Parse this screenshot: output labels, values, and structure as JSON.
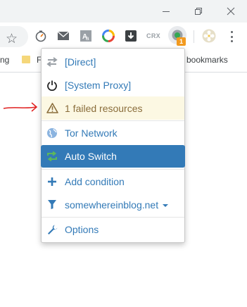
{
  "browser": {
    "bookmarks_bar": {
      "left_text": "ng",
      "folder_text": "F",
      "right_text": "er bookmarks"
    },
    "toolbar": {
      "extensions": [
        "timer-icon",
        "mail-icon",
        "aa-icon",
        "color-wheel-icon",
        "download-icon",
        "crx-icon",
        "proxy-icon"
      ],
      "extension_crx_label": "CRX",
      "proxy_badge": "1"
    },
    "colors": {
      "accent": "#337ab7",
      "warning_bg": "#fcf8e3",
      "warning_text": "#8a6d3b",
      "badge": "#f29a1f",
      "annotation": "#e02020"
    }
  },
  "menu": {
    "items": [
      {
        "label": "[Direct]",
        "icon": "transfer-icon"
      },
      {
        "label": "[System Proxy]",
        "icon": "power-icon"
      },
      {
        "label": "1 failed resources",
        "icon": "warning-icon"
      },
      {
        "label": "Tor Network",
        "icon": "globe-icon"
      },
      {
        "label": "Auto Switch",
        "icon": "retweet-icon",
        "selected": true
      },
      {
        "label": "Add condition",
        "icon": "plus-icon"
      },
      {
        "label": "somewhereinblog.net",
        "icon": "filter-icon"
      },
      {
        "label": "Options",
        "icon": "wrench-icon"
      }
    ]
  }
}
